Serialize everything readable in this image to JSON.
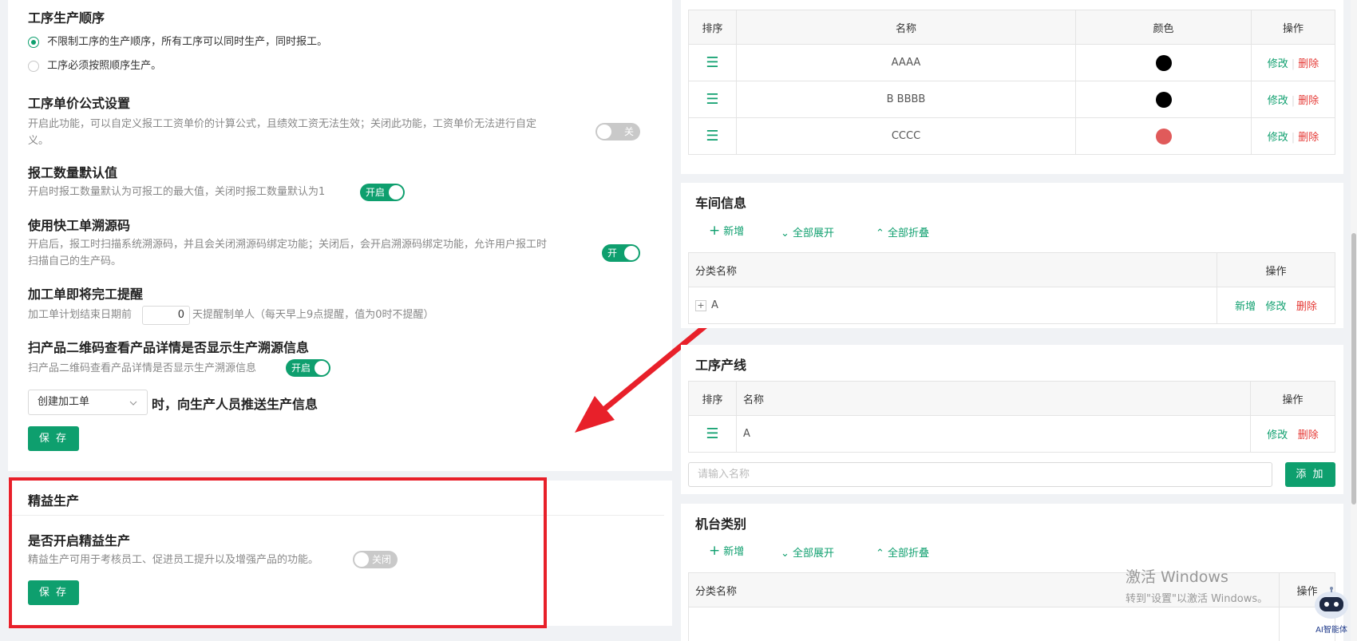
{
  "left": {
    "process_order": {
      "title": "工序生产顺序",
      "option1": "不限制工序的生产顺序，所有工序可以同时生产，同时报工。",
      "option2": "工序必须按照顺序生产。"
    },
    "price_formula": {
      "title": "工序单价公式设置",
      "desc_line1": "开启此功能，可以自定义报工工资单价的计算公式，且绩效工资无法生效；关闭此功能，工资单价无法进行自定",
      "desc_line2": "义。",
      "switch_label": "关"
    },
    "report_default": {
      "title": "报工数量默认值",
      "desc": "开启时报工数量默认为可报工的最大值，关闭时报工数量默认为1",
      "switch_label": "开启"
    },
    "trace_code": {
      "title": "使用快工单溯源码",
      "desc_line1": "开启后，报工时扫描系统溯源码，并且会关闭溯源码绑定功能；关闭后，会开启溯源码绑定功能，允许用户报工时",
      "desc_line2": "扫描自己的生产码。",
      "switch_label": "开"
    },
    "reminder": {
      "title": "加工单即将完工提醒",
      "prefix": "加工单计划结束日期前",
      "days": "0",
      "suffix": "天提醒制单人（每天早上9点提醒，值为0时不提醒）"
    },
    "qr_trace": {
      "title": "扫产品二维码查看产品详情是否显示生产溯源信息",
      "desc": "扫产品二维码查看产品详情是否显示生产溯源信息",
      "switch_label": "开启"
    },
    "push": {
      "select_value": "创建加工单",
      "suffix": "时，向生产人员推送生产信息"
    },
    "save_label": "保 存",
    "lean": {
      "section_title": "精益生产",
      "title": "是否开启精益生产",
      "desc": "精益生产可用于考核员工、促进员工提升以及增强产品的功能。",
      "switch_label": "关闭",
      "save_label": "保 存"
    }
  },
  "right": {
    "color_table": {
      "headers": [
        "排序",
        "名称",
        "颜色",
        "操作"
      ],
      "rows": [
        {
          "name": "AAAA",
          "color": "#000000"
        },
        {
          "name": "B BBBB",
          "color": "#000000"
        },
        {
          "name": "CCCC",
          "color": "#e05a5a"
        }
      ],
      "edit": "修改",
      "delete": "删除"
    },
    "workshop": {
      "title": "车间信息",
      "add": "新增",
      "expand": "全部展开",
      "collapse": "全部折叠",
      "headers": [
        "分类名称",
        "操作"
      ],
      "row_name": "A",
      "row_add": "新增",
      "row_edit": "修改",
      "row_delete": "删除"
    },
    "process_line": {
      "title": "工序产线",
      "headers": [
        "排序",
        "名称",
        "操作"
      ],
      "row_name": "A",
      "edit": "修改",
      "delete": "删除",
      "input_placeholder": "请输入名称",
      "add_button": "添 加"
    },
    "machine": {
      "title": "机台类别",
      "add": "新增",
      "expand": "全部展开",
      "collapse": "全部折叠",
      "headers": [
        "分类名称",
        "操作"
      ]
    }
  },
  "watermark": {
    "line1": "激活 Windows",
    "line2": "转到\"设置\"以激活 Windows。"
  },
  "ai_assistant": "AI智能体"
}
